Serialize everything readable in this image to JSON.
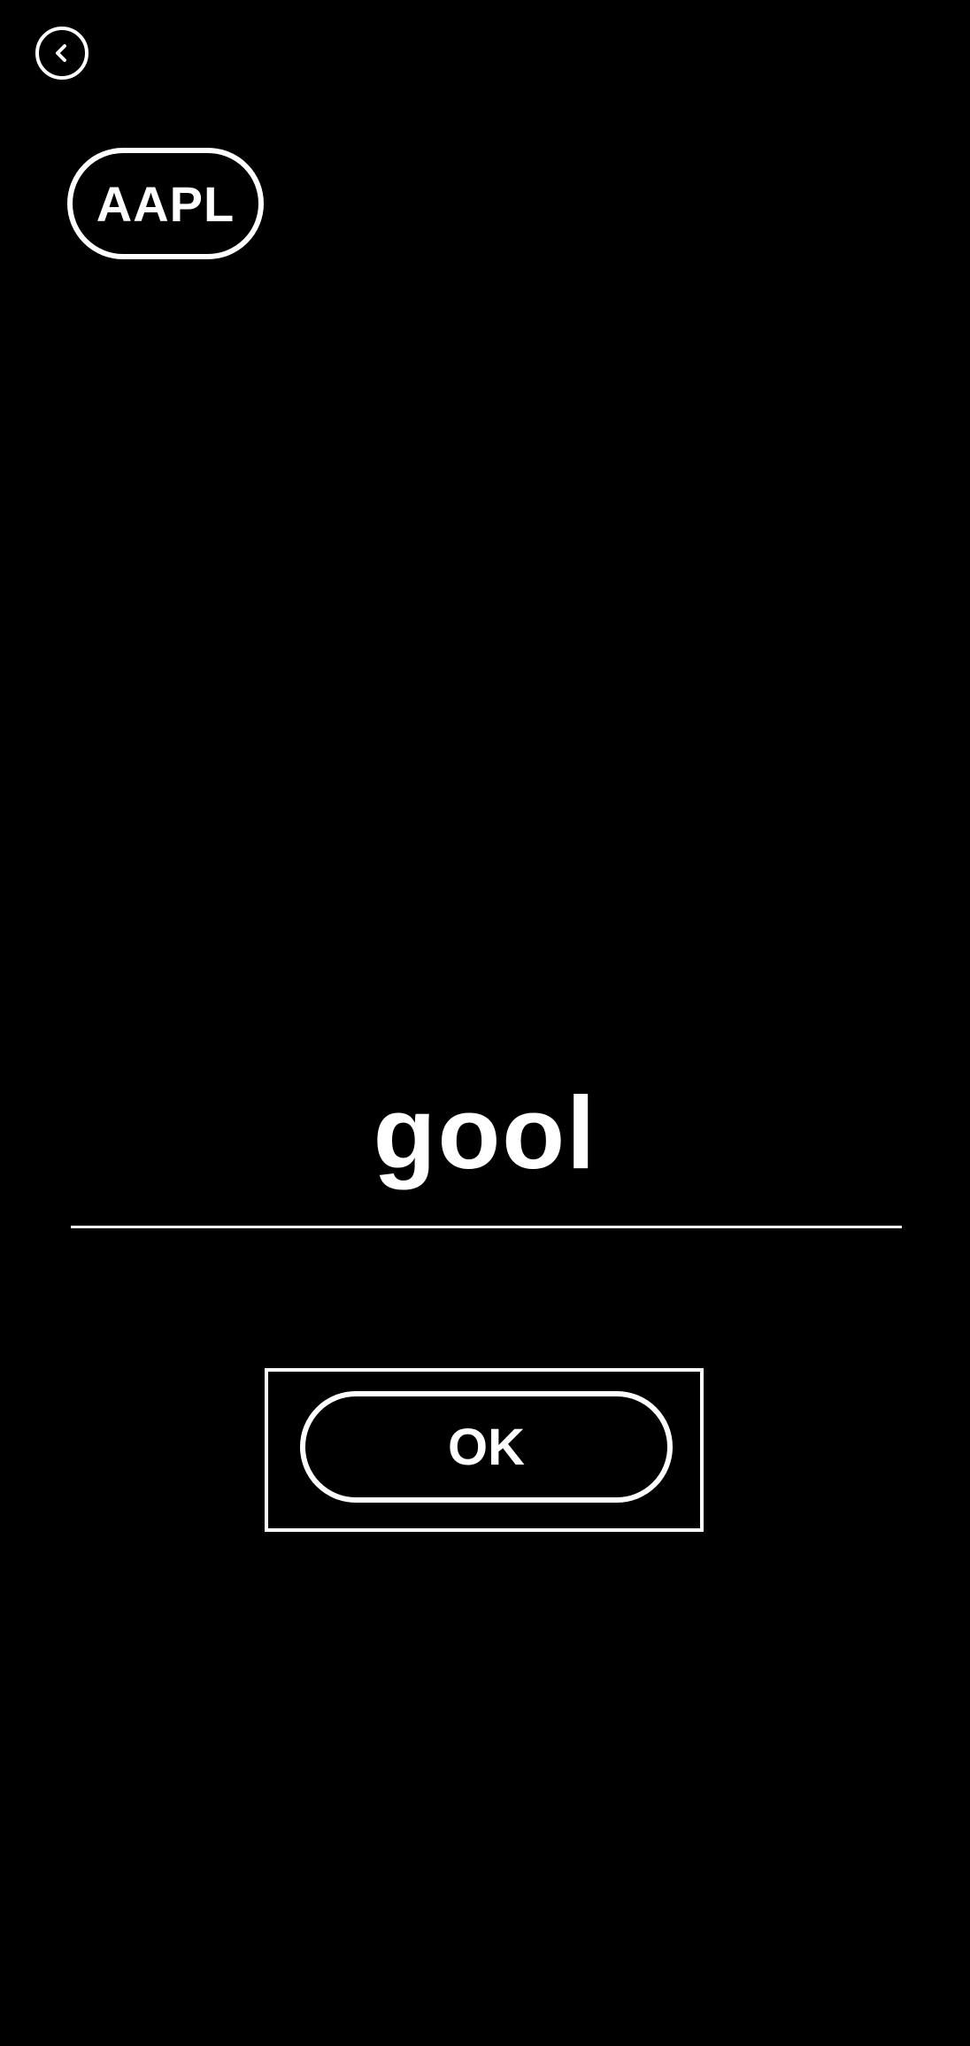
{
  "header": {
    "back_icon": "chevron-left-icon",
    "ticker": "AAPL"
  },
  "main": {
    "answer": "gool",
    "ok_label": "OK"
  },
  "colors": {
    "background": "#000000",
    "foreground": "#ffffff"
  }
}
